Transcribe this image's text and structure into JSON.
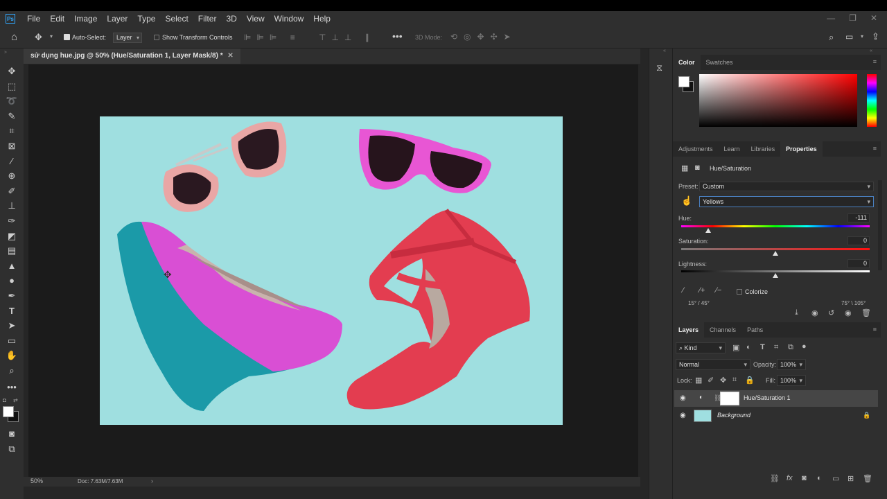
{
  "app": {
    "logo": "Ps"
  },
  "menu": [
    "File",
    "Edit",
    "Image",
    "Layer",
    "Type",
    "Select",
    "Filter",
    "3D",
    "View",
    "Window",
    "Help"
  ],
  "options": {
    "auto_select_label": "Auto-Select:",
    "auto_select_value": "Layer",
    "show_transform_label": "Show Transform Controls",
    "mode_3d_label": "3D Mode:"
  },
  "document": {
    "tab_title": "sử dụng hue.jpg @ 50% (Hue/Saturation 1, Layer Mask/8) *",
    "zoom": "50%",
    "doc_size": "Doc: 7.63M/7.63M"
  },
  "color_panel": {
    "tabs": [
      "Color",
      "Swatches"
    ]
  },
  "properties_panel": {
    "tabs": [
      "Adjustments",
      "Learn",
      "Libraries",
      "Properties"
    ],
    "title": "Hue/Saturation",
    "preset_label": "Preset:",
    "preset_value": "Custom",
    "channel_value": "Yellows",
    "hue_label": "Hue:",
    "hue_value": "-111",
    "saturation_label": "Saturation:",
    "saturation_value": "0",
    "lightness_label": "Lightness:",
    "lightness_value": "0",
    "colorize_label": "Colorize",
    "range_left": "15° / 45°",
    "range_right": "75° \\ 105°"
  },
  "layers_panel": {
    "tabs": [
      "Layers",
      "Channels",
      "Paths"
    ],
    "filter_kind": "Kind",
    "blend_mode": "Normal",
    "opacity_label": "Opacity:",
    "opacity_value": "100%",
    "lock_label": "Lock:",
    "fill_label": "Fill:",
    "fill_value": "100%",
    "layers": [
      {
        "name": "Hue/Saturation 1"
      },
      {
        "name": "Background"
      }
    ]
  },
  "colors": {
    "accent": "#31a8ff",
    "photo_bg": "#9fdfe0"
  }
}
